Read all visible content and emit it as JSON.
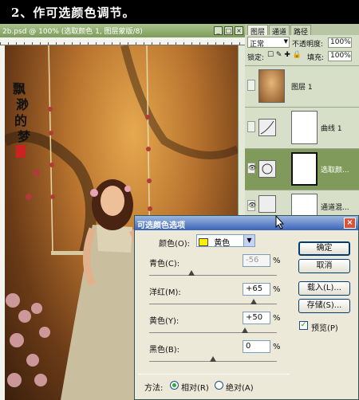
{
  "banner": {
    "title": "2、作可选颜色调节。"
  },
  "document": {
    "title": "2b.psd @ 100% (选取颜色 1, 图层蒙版/8)",
    "watermark_text": "飘渺的梦"
  },
  "layers_panel": {
    "tabs": [
      "图层",
      "通道",
      "路径"
    ],
    "blend_mode": "正常",
    "opacity_label": "不透明度:",
    "opacity_value": "100%",
    "lock_label": "锁定:",
    "fill_label": "填充:",
    "fill_value": "100%",
    "layers": [
      {
        "name": "图层 1",
        "visible": false
      },
      {
        "name": "曲线 1",
        "visible": false
      },
      {
        "name": "选取颜...",
        "visible": true,
        "selected": true
      },
      {
        "name": "通道混...",
        "visible": true
      }
    ]
  },
  "dialog": {
    "title": "可选颜色选项",
    "close_label": "×",
    "colors_label": "颜色(O):",
    "colors_value": "黄色",
    "sliders": [
      {
        "label": "青色(C):",
        "value": "-56",
        "unit": "%",
        "position": 0.22,
        "disabled": true
      },
      {
        "label": "洋红(M):",
        "value": "+65",
        "unit": "%",
        "position": 0.82
      },
      {
        "label": "黄色(Y):",
        "value": "+50",
        "unit": "%",
        "position": 0.75
      },
      {
        "label": "黑色(B):",
        "value": "0",
        "unit": "%",
        "position": 0.5
      }
    ],
    "buttons": {
      "ok": "确定",
      "cancel": "取消",
      "load": "载入(L)...",
      "save": "存储(S)..."
    },
    "preview_label": "预览(P)",
    "method_label": "方法:",
    "method_relative": "相对(R)",
    "method_absolute": "绝对(A)"
  },
  "colors": {
    "panel_green": "#7d9b5c",
    "selected_layer": "#7f9a5a",
    "dialog_title_blue": "#3b64b8"
  }
}
